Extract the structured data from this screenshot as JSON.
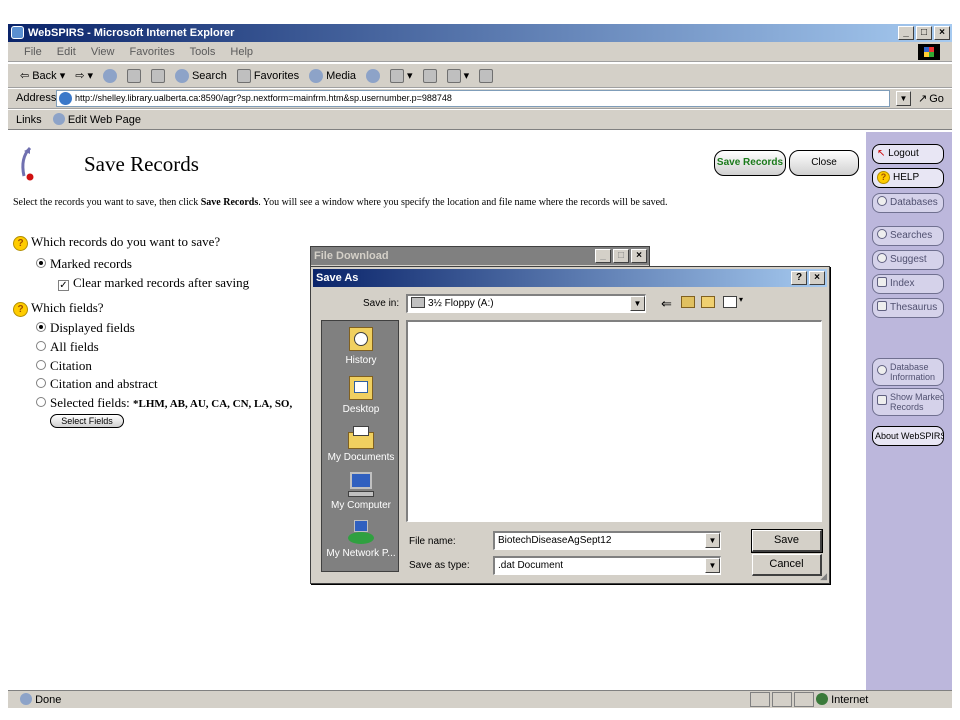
{
  "window": {
    "title": "WebSPIRS - Microsoft Internet Explorer",
    "controls": [
      "_",
      "□",
      "×"
    ]
  },
  "menu": [
    "File",
    "Edit",
    "View",
    "Favorites",
    "Tools",
    "Help"
  ],
  "toolbar": {
    "back": "Back",
    "search": "Search",
    "favorites": "Favorites",
    "media": "Media"
  },
  "address": {
    "label": "Address",
    "url": "http://shelley.library.ualberta.ca:8590/agr?sp.nextform=mainfrm.htm&sp.usernumber.p=988748",
    "go": "Go"
  },
  "links": {
    "label": "Links",
    "edit": "Edit Web Page"
  },
  "page": {
    "title": "Save Records",
    "save_records_btn": "Save Records",
    "close_btn": "Close",
    "instructions_pre": "Select the records you want to save, then click ",
    "instructions_bold": "Save Records",
    "instructions_post": ". You will see a window where you specify the location and file name where the records will be saved.",
    "q1": "Which records do you want to save?",
    "q1_opt": "Marked records",
    "q1_check": "Clear marked records after saving",
    "q2": "Which fields?",
    "fields": {
      "displayed": "Displayed fields",
      "all": "All fields",
      "citation": "Citation",
      "citation_abstract": "Citation and abstract",
      "selected_label": "Selected fields: ",
      "selected_value": "*LHM, AB, AU, CA, CN, LA, SO,"
    },
    "select_fields_btn": "Select Fields"
  },
  "sidebar": {
    "logout": "Logout",
    "help": "HELP",
    "databases": "Databases",
    "searches": "Searches",
    "suggest": "Suggest",
    "index": "Index",
    "thesaurus": "Thesaurus",
    "db_info_1": "Database",
    "db_info_2": "Information",
    "show_marked_1": "Show Marked",
    "show_marked_2": "Records",
    "about": "About WebSPIRS"
  },
  "status": {
    "text": "Done",
    "zone": "Internet"
  },
  "file_download": {
    "title": "File Download"
  },
  "save_as": {
    "title": "Save As",
    "help": "?",
    "close": "×",
    "save_in_label": "Save in:",
    "save_in_value": "3½ Floppy (A:)",
    "places": [
      "History",
      "Desktop",
      "My Documents",
      "My Computer",
      "My Network P..."
    ],
    "file_name_label": "File name:",
    "file_name_value": "BiotechDiseaseAgSept12",
    "save_type_label": "Save as type:",
    "save_type_value": ".dat Document",
    "save_btn": "Save",
    "cancel_btn": "Cancel"
  },
  "colors": {
    "title_bar": "#0a246a",
    "chrome": "#d4d0c8",
    "sidebar": "#bcb7dc",
    "save_green": "#1a7a1a",
    "question_icon": "#ffcc00"
  }
}
